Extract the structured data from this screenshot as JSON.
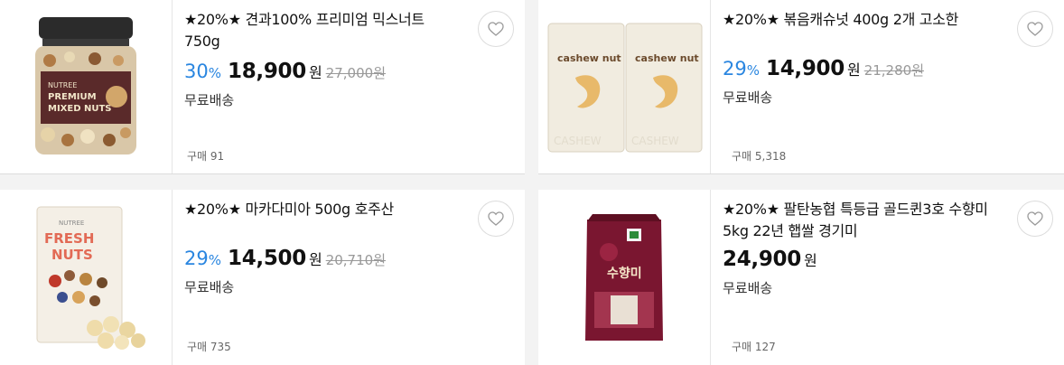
{
  "products": [
    {
      "title": "★20%★ 견과100% 프리미엄 믹스너트 750g",
      "discount_rate": "30",
      "rate_unit": "%",
      "price": "18,900",
      "currency": "원",
      "original_price": "27,000원",
      "shipping": "무료배송",
      "purchases": "구매 91",
      "image_label": "NUTREE PREMIUM MIXED NUTS"
    },
    {
      "title": "★20%★ 볶음캐슈넛 400g 2개 고소한",
      "discount_rate": "29",
      "rate_unit": "%",
      "price": "14,900",
      "currency": "원",
      "original_price": "21,280원",
      "shipping": "무료배송",
      "purchases": "구매 5,318",
      "image_label": "cashew nut"
    },
    {
      "title": "★20%★ 마카다미아 500g 호주산",
      "discount_rate": "29",
      "rate_unit": "%",
      "price": "14,500",
      "currency": "원",
      "original_price": "20,710원",
      "shipping": "무료배송",
      "purchases": "구매 735",
      "image_label": "FRESH NUTS"
    },
    {
      "title": "★20%★ 팔탄농협 특등급 골드퀸3호 수향미 5kg 22년 햅쌀 경기미",
      "price": "24,900",
      "currency": "원",
      "shipping": "무료배송",
      "purchases": "구매 127",
      "image_label": "수향미"
    }
  ],
  "colors": {
    "discount": "#2a86e0",
    "price": "#111111",
    "original": "#999999",
    "background": "#f3f3f3"
  },
  "icons": [
    "heart-icon"
  ]
}
